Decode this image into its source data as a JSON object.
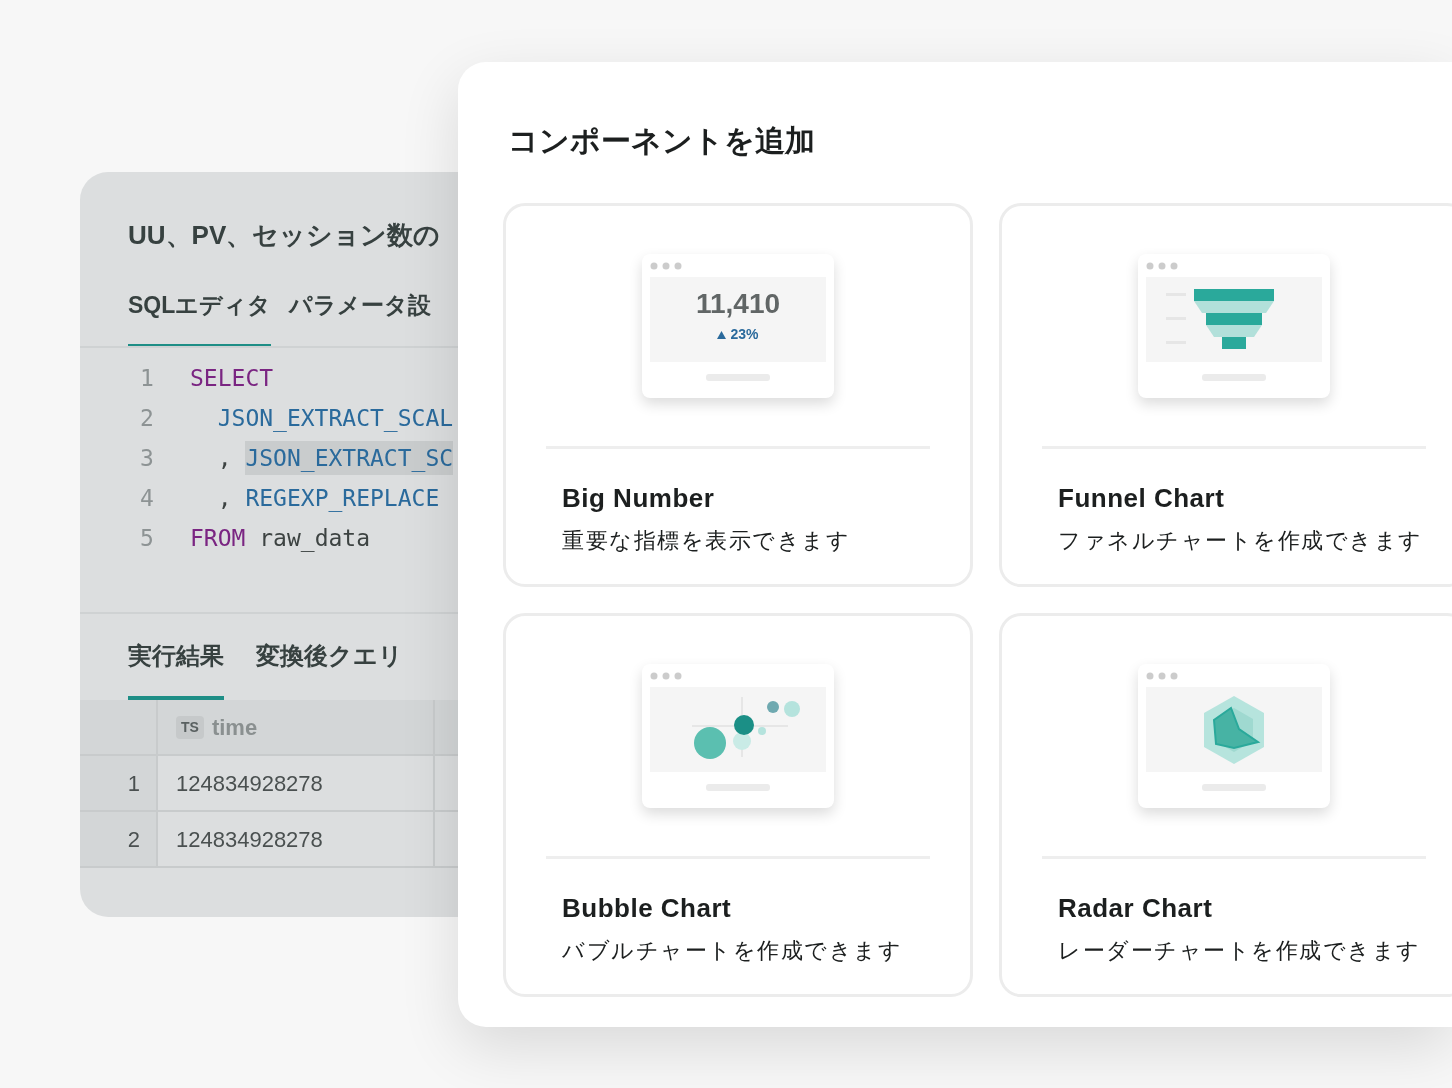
{
  "background_panel": {
    "title": "UU、PV、セッション数の",
    "editor_tabs": [
      {
        "label": "SQLエディタ",
        "selected": true
      },
      {
        "label": "パラメータ設",
        "selected": false
      }
    ],
    "code_lines": [
      {
        "number": "1",
        "tokens": [
          {
            "kind": "keyword",
            "text": "SELECT",
            "highlighted": false
          }
        ]
      },
      {
        "number": "2",
        "tokens": [
          {
            "kind": "function",
            "text": "  JSON_EXTRACT_SCAL",
            "highlighted": false
          }
        ]
      },
      {
        "number": "3",
        "tokens": [
          {
            "kind": "plain",
            "text": "  , ",
            "highlighted": false
          },
          {
            "kind": "function",
            "text": "JSON_EXTRACT_SC",
            "highlighted": true
          }
        ]
      },
      {
        "number": "4",
        "tokens": [
          {
            "kind": "plain",
            "text": "  , ",
            "highlighted": false
          },
          {
            "kind": "function",
            "text": "REGEXP_REPLACE",
            "highlighted": false
          }
        ]
      },
      {
        "number": "5",
        "tokens": [
          {
            "kind": "keyword",
            "text": "FROM",
            "highlighted": false
          },
          {
            "kind": "plain",
            "text": " raw_data",
            "highlighted": false
          }
        ]
      }
    ],
    "result_tabs": [
      {
        "label": "実行結果",
        "selected": true
      },
      {
        "label": "変換後クエリ",
        "selected": false
      }
    ],
    "table": {
      "columns": [
        {
          "type_badge": "TS",
          "label": "time"
        }
      ],
      "rows": [
        {
          "index": "1",
          "cells": [
            "124834928278"
          ]
        },
        {
          "index": "2",
          "cells": [
            "124834928278"
          ]
        }
      ]
    }
  },
  "dialog": {
    "title": "コンポーネントを追加",
    "components": [
      {
        "kind": "big_number",
        "name": "Big Number",
        "description": "重要な指標を表示できます",
        "preview_value": "11,410",
        "preview_change": "23%"
      },
      {
        "kind": "funnel",
        "name": "Funnel Chart",
        "description": "ファネルチャートを作成できます"
      },
      {
        "kind": "bubble",
        "name": "Bubble Chart",
        "description": "バブルチャートを作成できます"
      },
      {
        "kind": "radar",
        "name": "Radar Chart",
        "description": "レーダーチャートを作成できます"
      }
    ]
  }
}
